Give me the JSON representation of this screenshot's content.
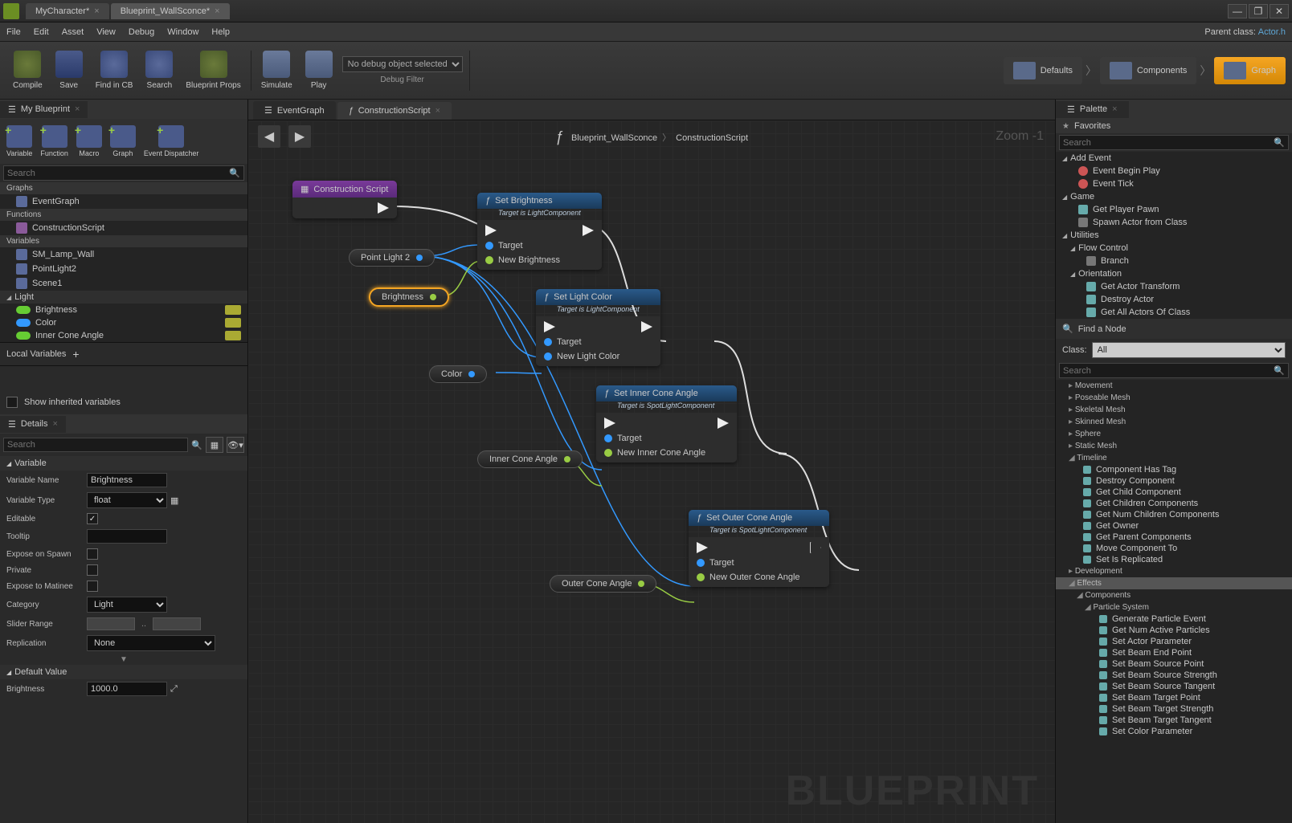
{
  "titlebar": {
    "tabs": [
      {
        "label": "MyCharacter*"
      },
      {
        "label": "Blueprint_WallSconce*"
      }
    ],
    "windowButtons": {
      "min": "—",
      "restore": "❐",
      "close": "✕"
    }
  },
  "menubar": {
    "items": [
      "File",
      "Edit",
      "Asset",
      "View",
      "Debug",
      "Window",
      "Help"
    ],
    "parentLabel": "Parent class:",
    "parentClass": "Actor.h"
  },
  "toolbar": {
    "compile": "Compile",
    "save": "Save",
    "findincb": "Find in CB",
    "search": "Search",
    "bpprops": "Blueprint Props",
    "simulate": "Simulate",
    "play": "Play",
    "debugSelect": "No debug object selected",
    "debugFilter": "Debug Filter",
    "defaults": "Defaults",
    "components": "Components",
    "graph": "Graph"
  },
  "myBlueprint": {
    "title": "My Blueprint",
    "addButtons": [
      "Variable",
      "Function",
      "Macro",
      "Graph",
      "Event Dispatcher"
    ],
    "searchPlaceholder": "Search",
    "graphsHdr": "Graphs",
    "eventGraph": "EventGraph",
    "functionsHdr": "Functions",
    "constructionScript": "ConstructionScript",
    "variablesHdr": "Variables",
    "vars": [
      "SM_Lamp_Wall",
      "PointLight2",
      "Scene1"
    ],
    "lightCat": "Light",
    "lightVars": [
      "Brightness",
      "Color",
      "Inner Cone Angle"
    ],
    "localVars": "Local Variables",
    "showInherited": "Show inherited variables"
  },
  "details": {
    "title": "Details",
    "searchPlaceholder": "Search",
    "varSection": "Variable",
    "rows": {
      "name": {
        "label": "Variable Name",
        "value": "Brightness"
      },
      "type": {
        "label": "Variable Type",
        "value": "float"
      },
      "editable": {
        "label": "Editable",
        "checked": true
      },
      "tooltip": {
        "label": "Tooltip",
        "value": ""
      },
      "spawn": {
        "label": "Expose on Spawn",
        "checked": false
      },
      "private": {
        "label": "Private",
        "checked": false
      },
      "matinee": {
        "label": "Expose to Matinee",
        "checked": false
      },
      "category": {
        "label": "Category",
        "value": "Light"
      },
      "slider": {
        "label": "Slider Range"
      },
      "replication": {
        "label": "Replication",
        "value": "None"
      }
    },
    "defaultSection": "Default Value",
    "defaultRow": {
      "label": "Brightness",
      "value": "1000.0"
    }
  },
  "centerTabs": {
    "event": "EventGraph",
    "construction": "ConstructionScript"
  },
  "graph": {
    "blueprintName": "Blueprint_WallSconce",
    "scriptName": "ConstructionScript",
    "zoom": "Zoom -1",
    "watermark": "BLUEPRINT",
    "nodes": {
      "cs": "Construction Script",
      "setBrightness": {
        "title": "Set Brightness",
        "sub": "Target is LightComponent",
        "target": "Target",
        "newval": "New Brightness"
      },
      "setLightColor": {
        "title": "Set Light Color",
        "sub": "Target is LightComponent",
        "target": "Target",
        "newval": "New Light Color"
      },
      "setInner": {
        "title": "Set Inner Cone Angle",
        "sub": "Target is SpotLightComponent",
        "target": "Target",
        "newval": "New Inner Cone Angle"
      },
      "setOuter": {
        "title": "Set Outer Cone Angle",
        "sub": "Target is SpotLightComponent",
        "target": "Target",
        "newval": "New Outer Cone Angle"
      }
    },
    "pills": {
      "pointlight": "Point Light 2",
      "brightness": "Brightness",
      "color": "Color",
      "inner": "Inner Cone Angle",
      "outer": "Outer Cone Angle"
    }
  },
  "palette": {
    "title": "Palette",
    "favorites": "Favorites",
    "searchPlaceholder": "Search",
    "addEvent": "Add Event",
    "eventBeginPlay": "Event Begin Play",
    "eventTick": "Event Tick",
    "game": "Game",
    "getPlayerPawn": "Get Player Pawn",
    "spawnActor": "Spawn Actor from Class",
    "utilities": "Utilities",
    "flowControl": "Flow Control",
    "branch": "Branch",
    "orientation": "Orientation",
    "getActorTransform": "Get Actor Transform",
    "destroyActor": "Destroy Actor",
    "getAllActors": "Get All Actors Of Class",
    "findNode": "Find a Node",
    "classLabel": "Class:",
    "classValue": "All",
    "nodeCats": [
      "Movement",
      "Poseable Mesh",
      "Skeletal Mesh",
      "Skinned Mesh",
      "Sphere",
      "Static Mesh",
      "Timeline"
    ],
    "timelineItems": [
      "Component Has Tag",
      "Destroy Component",
      "Get Child Component",
      "Get Children Components",
      "Get Num Children Components",
      "Get Owner",
      "Get Parent Components",
      "Move Component To",
      "Set Is Replicated"
    ],
    "dev": "Development",
    "effects": "Effects",
    "components": "Components",
    "particle": "Particle System",
    "particleItems": [
      "Generate Particle Event",
      "Get Num Active Particles",
      "Set Actor Parameter",
      "Set Beam End Point",
      "Set Beam Source Point",
      "Set Beam Source Strength",
      "Set Beam Source Tangent",
      "Set Beam Target Point",
      "Set Beam Target Strength",
      "Set Beam Target Tangent",
      "Set Color Parameter"
    ]
  }
}
